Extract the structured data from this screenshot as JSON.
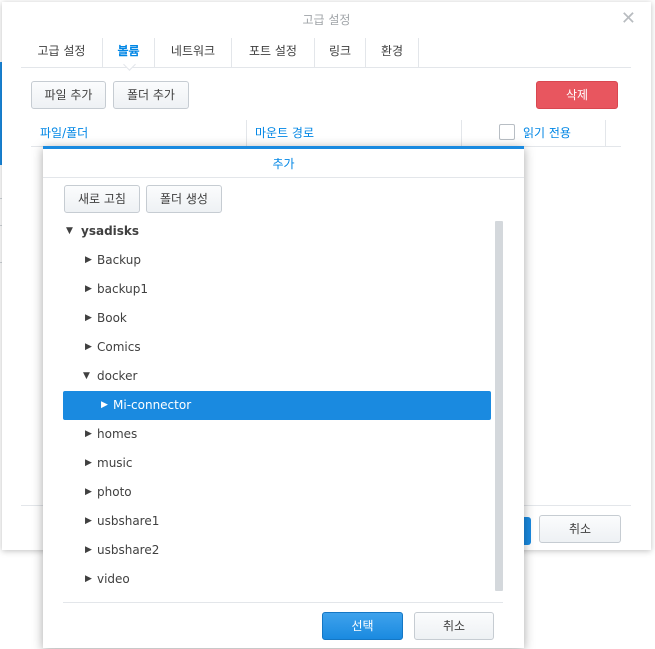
{
  "main_dialog": {
    "title": "고급 설정",
    "close_glyph": "✕",
    "tabs": [
      {
        "label": "고급 설정"
      },
      {
        "label": "볼륨"
      },
      {
        "label": "네트워크"
      },
      {
        "label": "포트 설정"
      },
      {
        "label": "링크"
      },
      {
        "label": "환경"
      }
    ],
    "active_tab": "볼륨",
    "toolbar": {
      "add_file_label": "파일 추가",
      "add_folder_label": "폴더 추가",
      "delete_label": "삭제"
    },
    "grid": {
      "columns": [
        "파일/폴더",
        "마운트 경로",
        "읽기 전용"
      ]
    },
    "footer": {
      "cancel_label": "취소"
    }
  },
  "add_dialog": {
    "title": "추가",
    "refresh_label": "새로 고침",
    "create_folder_label": "폴더 생성",
    "tree": {
      "root": "ysadisks",
      "items": [
        {
          "label": "Backup",
          "expanded": false
        },
        {
          "label": "backup1",
          "expanded": false
        },
        {
          "label": "Book",
          "expanded": false
        },
        {
          "label": "Comics",
          "expanded": false
        },
        {
          "label": "docker",
          "expanded": true
        },
        {
          "label": "Mi-connector",
          "expanded": false,
          "selected": true,
          "child_of": "docker"
        },
        {
          "label": "homes",
          "expanded": false
        },
        {
          "label": "music",
          "expanded": false
        },
        {
          "label": "photo",
          "expanded": false
        },
        {
          "label": "usbshare1",
          "expanded": false
        },
        {
          "label": "usbshare2",
          "expanded": false
        },
        {
          "label": "video",
          "expanded": false
        }
      ]
    },
    "select_label": "선택",
    "cancel_label": "취소"
  },
  "colors": {
    "accent": "#0086e5",
    "selection": "#1a8ae0",
    "danger": "#e8565f"
  },
  "icons": {
    "collapsed": "caret-right-icon",
    "expanded": "caret-down-icon"
  }
}
